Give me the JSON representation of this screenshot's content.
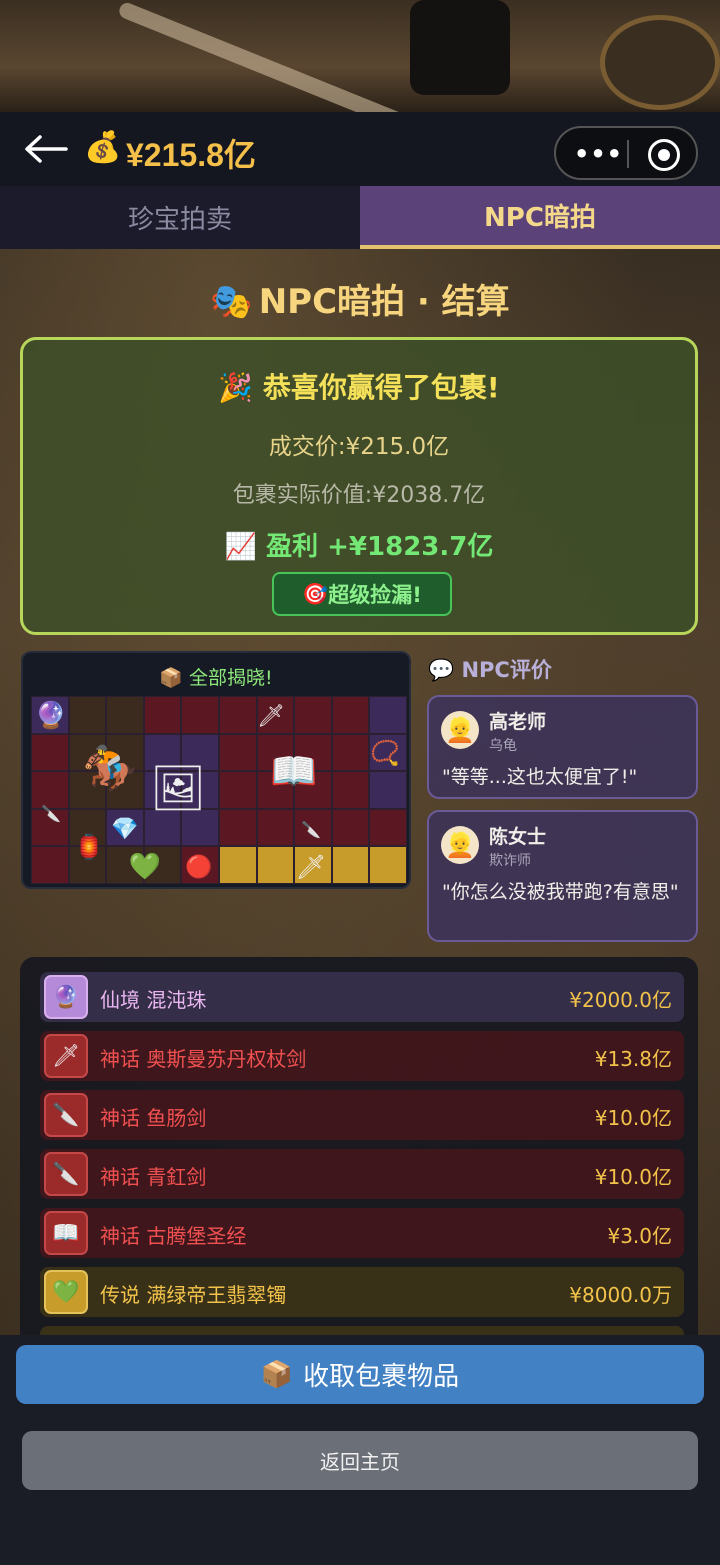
{
  "header": {
    "balance": "¥215.8亿",
    "money_icon": "💰",
    "more_icon": "•••"
  },
  "tabs": [
    {
      "label": "珍宝拍卖",
      "active": false
    },
    {
      "label": "NPC暗拍",
      "active": true
    }
  ],
  "settlement": {
    "title_icon": "🎭",
    "title": "NPC暗拍 · 结算",
    "win_icon": "🎉",
    "win_text": "恭喜你赢得了包裹!",
    "deal_price": "成交价:¥215.0亿",
    "real_value": "包裹实际价值:¥2038.7亿",
    "profit_icon": "📈",
    "profit": "盈利 +¥1823.7亿",
    "badge_icon": "🎯",
    "badge": "超级捡漏!"
  },
  "reveal": {
    "icon": "📦",
    "title": "全部揭晓!"
  },
  "npc_section": {
    "icon": "💬",
    "title": "NPC评价",
    "comments": [
      {
        "avatar": "👱",
        "name": "高老师",
        "role": "乌龟",
        "quote": "\"等等...这也太便宜了!\""
      },
      {
        "avatar": "👱",
        "name": "陈女士",
        "role": "欺诈师",
        "quote": "\"你怎么没被我带跑?有意思\""
      }
    ]
  },
  "items": [
    {
      "rarity": "仙境",
      "name": "仙境 混沌珠",
      "price": "¥2000.0亿",
      "icon": "🔮",
      "tier": "xianjing"
    },
    {
      "rarity": "神话",
      "name": "神话 奥斯曼苏丹权杖剑",
      "price": "¥13.8亿",
      "icon": "🗡",
      "tier": "shenhua"
    },
    {
      "rarity": "神话",
      "name": "神话 鱼肠剑",
      "price": "¥10.0亿",
      "icon": "🔪",
      "tier": "shenhua"
    },
    {
      "rarity": "神话",
      "name": "神话 青釭剑",
      "price": "¥10.0亿",
      "icon": "🔪",
      "tier": "shenhua"
    },
    {
      "rarity": "神话",
      "name": "神话 古腾堡圣经",
      "price": "¥3.0亿",
      "icon": "📖",
      "tier": "shenhua"
    },
    {
      "rarity": "传说",
      "name": "传说 满绿帝王翡翠镯",
      "price": "¥8000.0万",
      "icon": "💚",
      "tier": "chuanshuo"
    }
  ],
  "buttons": {
    "collect_icon": "📦",
    "collect": "收取包裹物品",
    "home": "返回主页"
  }
}
